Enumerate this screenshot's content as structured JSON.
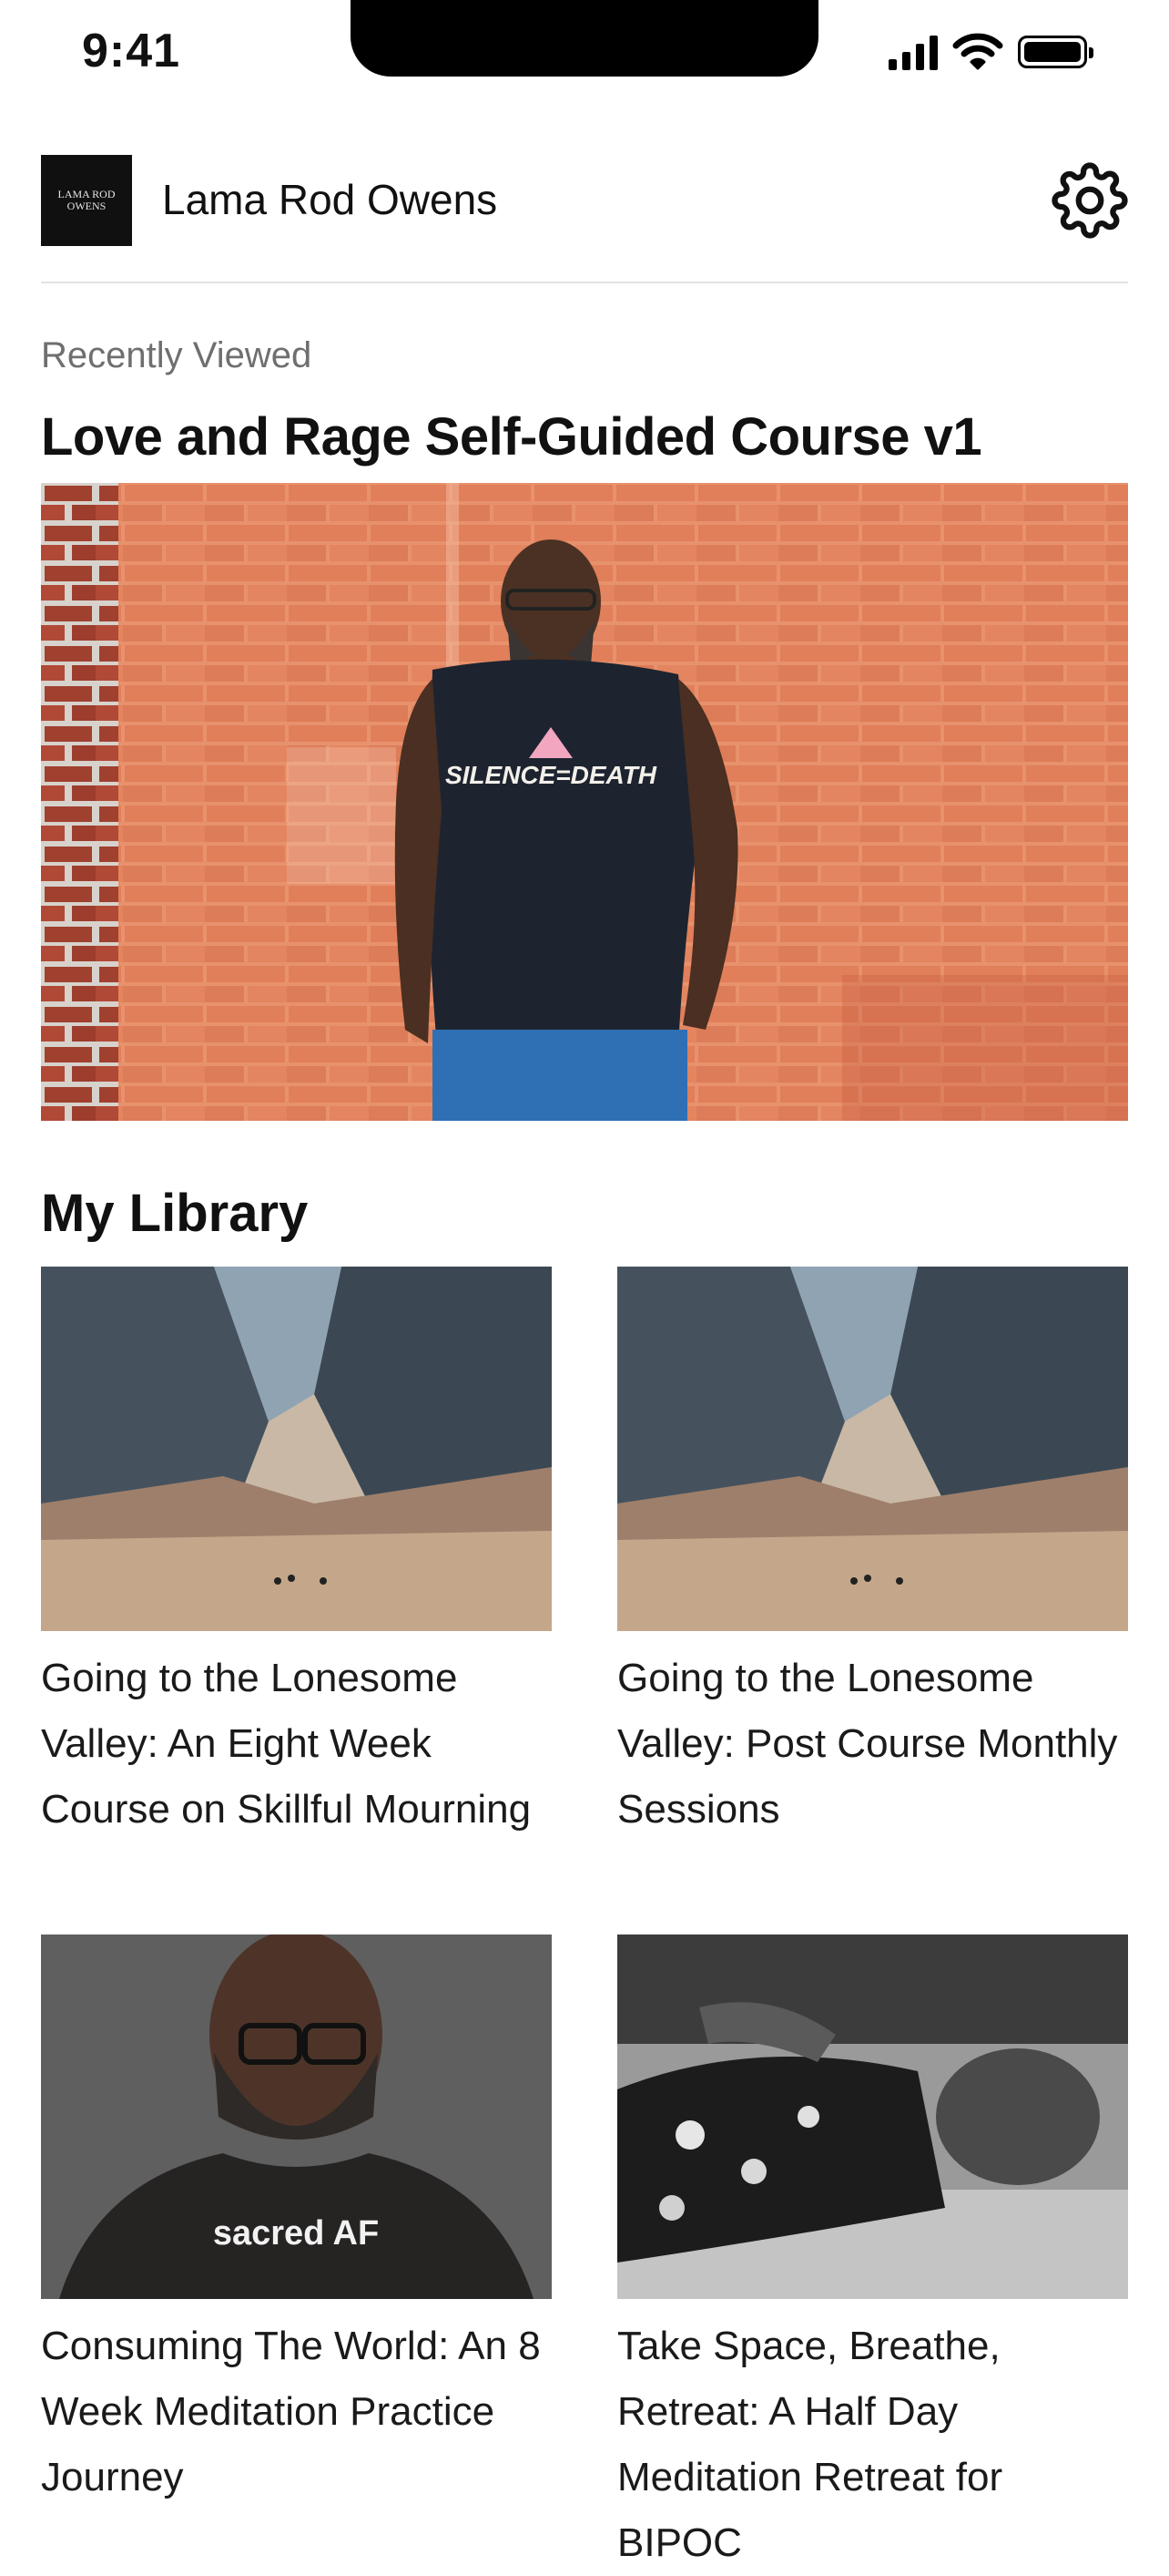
{
  "status_bar": {
    "time": "9:41"
  },
  "header": {
    "logo_text": "LAMA ROD OWENS",
    "title": "Lama Rod Owens",
    "settings_icon": "gear-icon"
  },
  "recently_viewed": {
    "label": "Recently Viewed",
    "course_title": "Love and Rage Self-Guided Course v1",
    "shirt_text": "SILENCE=DEATH"
  },
  "library": {
    "title": "My Library",
    "items": [
      {
        "title": "Going to the Lonesome Valley: An Eight Week Course on Skillful Mourning"
      },
      {
        "title": "Going to the Lonesome Valley: Post Course Monthly Sessions"
      },
      {
        "title": "Consuming The World: An 8 Week Meditation Practice Journey",
        "hoodie_text": "sacred AF"
      },
      {
        "title": "Take Space, Breathe, Retreat: A Half Day Meditation Retreat for BIPOC"
      }
    ]
  },
  "colors": {
    "brick": "#e08a66",
    "shirt": "#1d2430",
    "divider": "#e2e2e2",
    "text_muted": "#6f6f6f"
  }
}
